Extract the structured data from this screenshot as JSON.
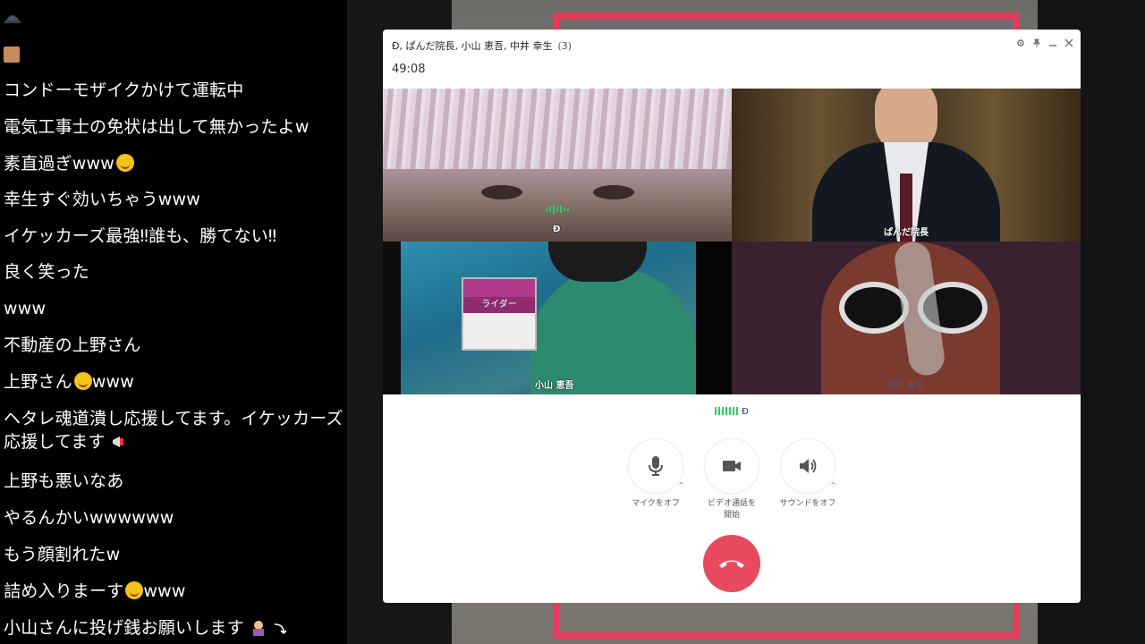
{
  "chat": {
    "messages": [
      "コンドーモザイクかけて運転中",
      "電気工事士の免状は出して無かったよw",
      "素直過ぎwww",
      "幸生すぐ効いちゃうwww",
      "イケッカーズ最強‼誰も、勝てない‼",
      "良く笑った",
      "www",
      "不動産の上野さん",
      "上野さん",
      "www",
      "ヘタレ魂道潰し応援してます。イケッカーズ応援してます",
      "上野も悪いなあ",
      "やるんかいwwwwww",
      "もう顔割れたw",
      "詰め入りまーす",
      "www",
      "小山さんに投げ銭お願いします"
    ]
  },
  "call": {
    "title": "Đ, ぱんだ院長, 小山 恵吾, 中井 幸生",
    "count": "(3)",
    "timer": "49:08",
    "participants": [
      {
        "name": "Đ"
      },
      {
        "name": "ぱんだ院長"
      },
      {
        "name": "小山 恵吾"
      },
      {
        "name": "中井 幸生"
      }
    ],
    "badge_text": "ライダー",
    "speaking": "Đ",
    "controls": {
      "mic": "マイクをオフ",
      "video_1": "ビデオ通話を",
      "video_2": "開始",
      "sound": "サウンドをオフ"
    }
  },
  "colors": {
    "accent_red": "#e84a5f",
    "frame_red": "#e83a5a",
    "voice_green": "#2ecc71"
  },
  "icons": [
    "settings-icon",
    "pin-icon",
    "minimize-icon",
    "close-icon",
    "mic-icon",
    "video-icon",
    "speaker-icon",
    "hangup-icon"
  ]
}
